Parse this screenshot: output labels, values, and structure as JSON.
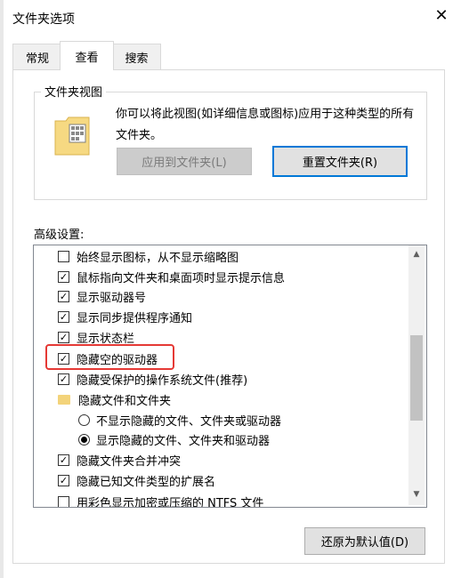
{
  "window": {
    "title": "文件夹选项",
    "close_glyph": "✕"
  },
  "tabs": [
    {
      "label": "常规"
    },
    {
      "label": "查看"
    },
    {
      "label": "搜索"
    }
  ],
  "folder_view": {
    "legend": "文件夹视图",
    "description": "你可以将此视图(如详细信息或图标)应用于这种类型的所有文件夹。",
    "apply_button": "应用到文件夹(L)",
    "reset_button": "重置文件夹(R)"
  },
  "advanced": {
    "label": "高级设置:",
    "items": [
      {
        "text": "始终显示图标，从不显示缩略图",
        "type": "checkbox",
        "checked": false
      },
      {
        "text": "鼠标指向文件夹和桌面项时显示提示信息",
        "type": "checkbox",
        "checked": true
      },
      {
        "text": "显示驱动器号",
        "type": "checkbox",
        "checked": true
      },
      {
        "text": "显示同步提供程序通知",
        "type": "checkbox",
        "checked": true
      },
      {
        "text": "显示状态栏",
        "type": "checkbox",
        "checked": true
      },
      {
        "text": "隐藏空的驱动器",
        "type": "checkbox",
        "checked": true
      },
      {
        "text": "隐藏受保护的操作系统文件(推荐)",
        "type": "checkbox",
        "checked": true
      },
      {
        "text": "隐藏文件和文件夹",
        "type": "folder"
      },
      {
        "text": "不显示隐藏的文件、文件夹或驱动器",
        "type": "radio",
        "checked": false
      },
      {
        "text": "显示隐藏的文件、文件夹和驱动器",
        "type": "radio",
        "checked": true
      },
      {
        "text": "隐藏文件夹合并冲突",
        "type": "checkbox",
        "checked": true
      },
      {
        "text": "隐藏已知文件类型的扩展名",
        "type": "checkbox",
        "checked": true
      },
      {
        "text": "用彩色显示加密或压缩的 NTFS 文件",
        "type": "checkbox",
        "checked": false
      }
    ]
  },
  "restore_button": "还原为默认值(D)",
  "colors": {
    "highlight": "#e53935",
    "focus": "#0078d7"
  }
}
